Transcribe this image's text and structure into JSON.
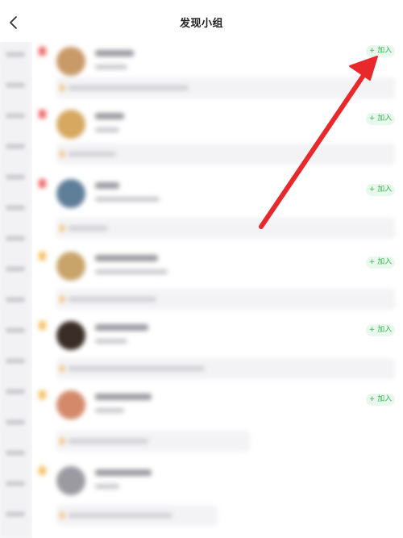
{
  "header": {
    "title": "发现小组"
  },
  "groups": [
    {
      "join_label": "+ 加入"
    },
    {
      "join_label": "+ 加入"
    },
    {
      "join_label": "+ 加入"
    },
    {
      "join_label": "+ 加入"
    },
    {
      "join_label": "+ 加入"
    },
    {
      "join_label": "+ 加入"
    },
    {
      "join_label": ""
    }
  ],
  "icons": {
    "back": "chevron-left-icon",
    "annotation": "red-arrow-annotation"
  },
  "colors": {
    "join_text": "#35b455",
    "join_bg": "#e9f8ec",
    "annotation_arrow": "#e8282b"
  }
}
